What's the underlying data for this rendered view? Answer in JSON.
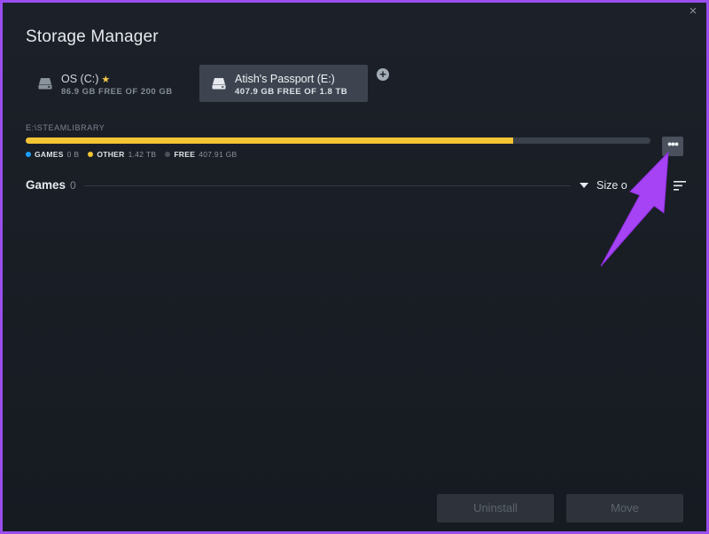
{
  "window": {
    "title": "Storage Manager",
    "close_glyph": "×"
  },
  "drives": [
    {
      "name": "OS (C:)",
      "sub": "86.9 GB FREE OF 200 GB",
      "starred": true,
      "selected": false,
      "icon": "drive-icon"
    },
    {
      "name": "Atish's Passport (E:)",
      "sub": "407.9 GB FREE OF 1.8 TB",
      "starred": false,
      "selected": true,
      "icon": "drive-icon"
    }
  ],
  "add_drive_glyph": "+",
  "library": {
    "path": "E:\\STEAMLIBRARY",
    "usage_fraction": {
      "games": 0.0,
      "other": 0.78,
      "free": 0.22
    },
    "legend": [
      {
        "label": "GAMES",
        "value": "0 B",
        "color": "#1a9fff"
      },
      {
        "label": "OTHER",
        "value": "1.42 TB",
        "color": "#f3c535"
      },
      {
        "label": "FREE",
        "value": "407.91 GB",
        "color": "#3b414a"
      }
    ],
    "more_glyph": "•••"
  },
  "games": {
    "label": "Games",
    "count": "0",
    "sort_label": "Size o"
  },
  "actions": {
    "uninstall": "Uninstall",
    "move": "Move"
  },
  "colors": {
    "accent_arrow": "#a644f5",
    "selected_tab": "#3d4450",
    "frame": "#9b4ef0"
  }
}
